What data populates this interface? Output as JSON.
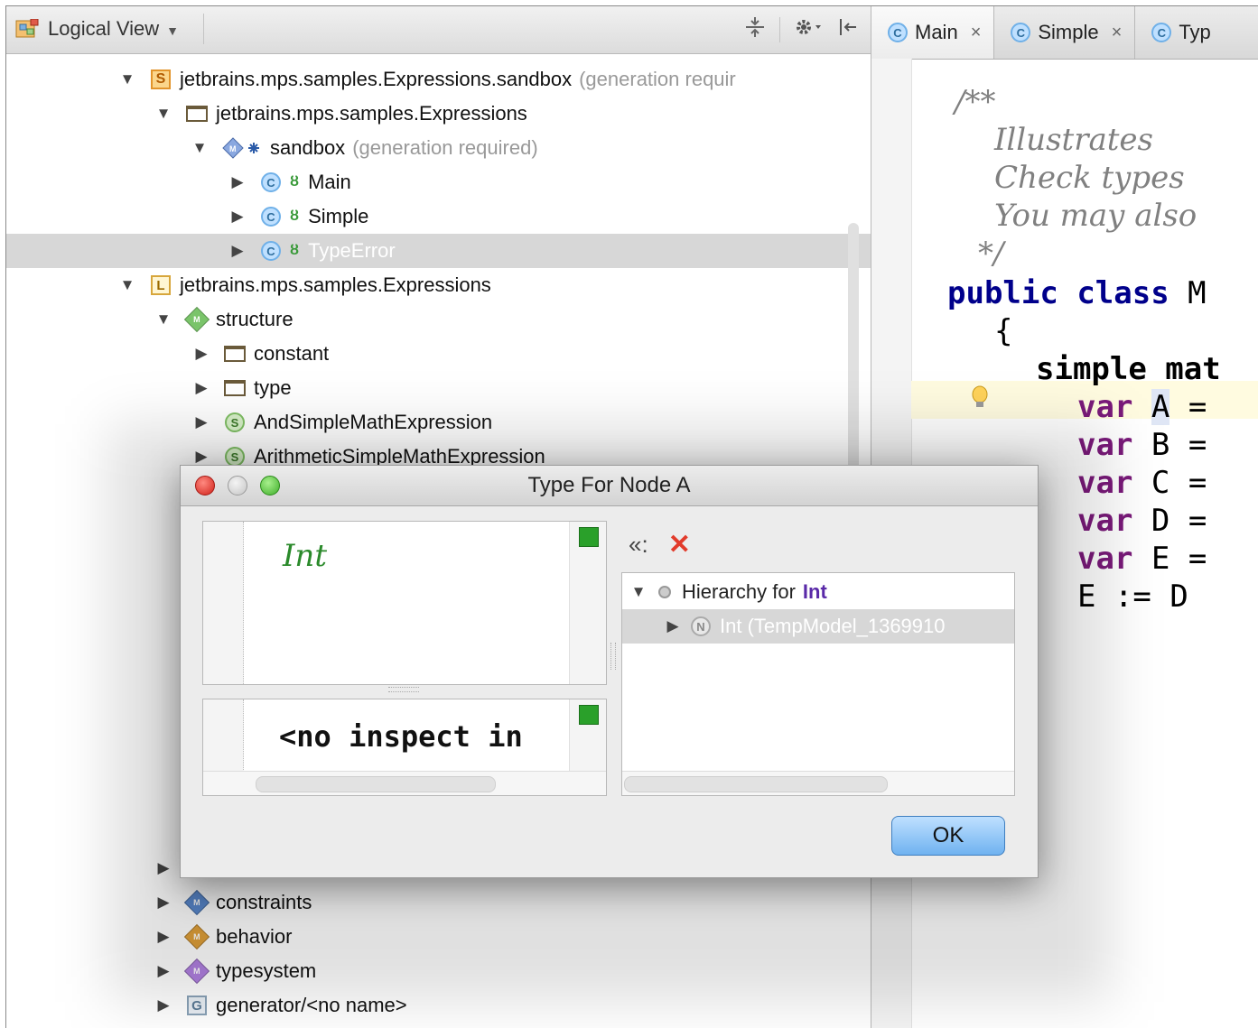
{
  "project_view": {
    "view_selector": "Logical View",
    "tree": [
      {
        "label": "jetbrains.mps.samples.Expressions.sandbox",
        "suffix": "(generation requir"
      },
      {
        "label": "jetbrains.mps.samples.Expressions",
        "suffix": ""
      },
      {
        "label": "sandbox",
        "suffix": "(generation required)"
      },
      {
        "label": "Main",
        "suffix": ""
      },
      {
        "label": "Simple",
        "suffix": ""
      },
      {
        "label": "TypeError",
        "suffix": ""
      },
      {
        "label": "jetbrains.mps.samples.Expressions",
        "suffix": ""
      },
      {
        "label": "structure",
        "suffix": ""
      },
      {
        "label": "constant",
        "suffix": ""
      },
      {
        "label": "type",
        "suffix": ""
      },
      {
        "label": "AndSimpleMathExpression",
        "suffix": ""
      },
      {
        "label": "ArithmeticSimpleMathExpression",
        "suffix": ""
      },
      {
        "label": "constraints",
        "suffix": ""
      },
      {
        "label": "behavior",
        "suffix": ""
      },
      {
        "label": "typesystem",
        "suffix": ""
      },
      {
        "label": "generator/<no name>",
        "suffix": ""
      }
    ],
    "badges": {
      "solution": "S",
      "language": "L",
      "generator": "G",
      "concept": "C",
      "simple": "S",
      "model": "M"
    }
  },
  "editor": {
    "tabs": [
      {
        "icon": "C",
        "label": "Main"
      },
      {
        "icon": "C",
        "label": "Simple"
      },
      {
        "icon": "C",
        "label": "Typ"
      }
    ],
    "tab_close": "×",
    "code": {
      "c1": "/**",
      "c2": "Illustrates",
      "c3": "Check types",
      "c4": "You may also",
      "c5": "*/",
      "kw_public": "public",
      "kw_class": "class",
      "class_name": "M",
      "brace": "{",
      "simple_math": "simple mat",
      "var_kw": "var",
      "vars": [
        "A",
        "B",
        "C",
        "D",
        "E"
      ],
      "eq": "=",
      "assign": "E := D"
    }
  },
  "dialog": {
    "title": "Type For Node A",
    "type_value": "Int",
    "inspector_text": "<no inspect in",
    "hierarchy_prefix": "Hierarchy for",
    "hierarchy_type": "Int",
    "hierarchy_child": "Int (TempModel_1369910",
    "child_badge": "N",
    "ok_label": "OK"
  },
  "colors": {
    "selection_gray": "#d7d7d7",
    "keyword_blue": "#00008b",
    "keyword_purple": "#7a1a7a",
    "type_green": "#2b8a2b",
    "close_red": "#e23b2b"
  }
}
